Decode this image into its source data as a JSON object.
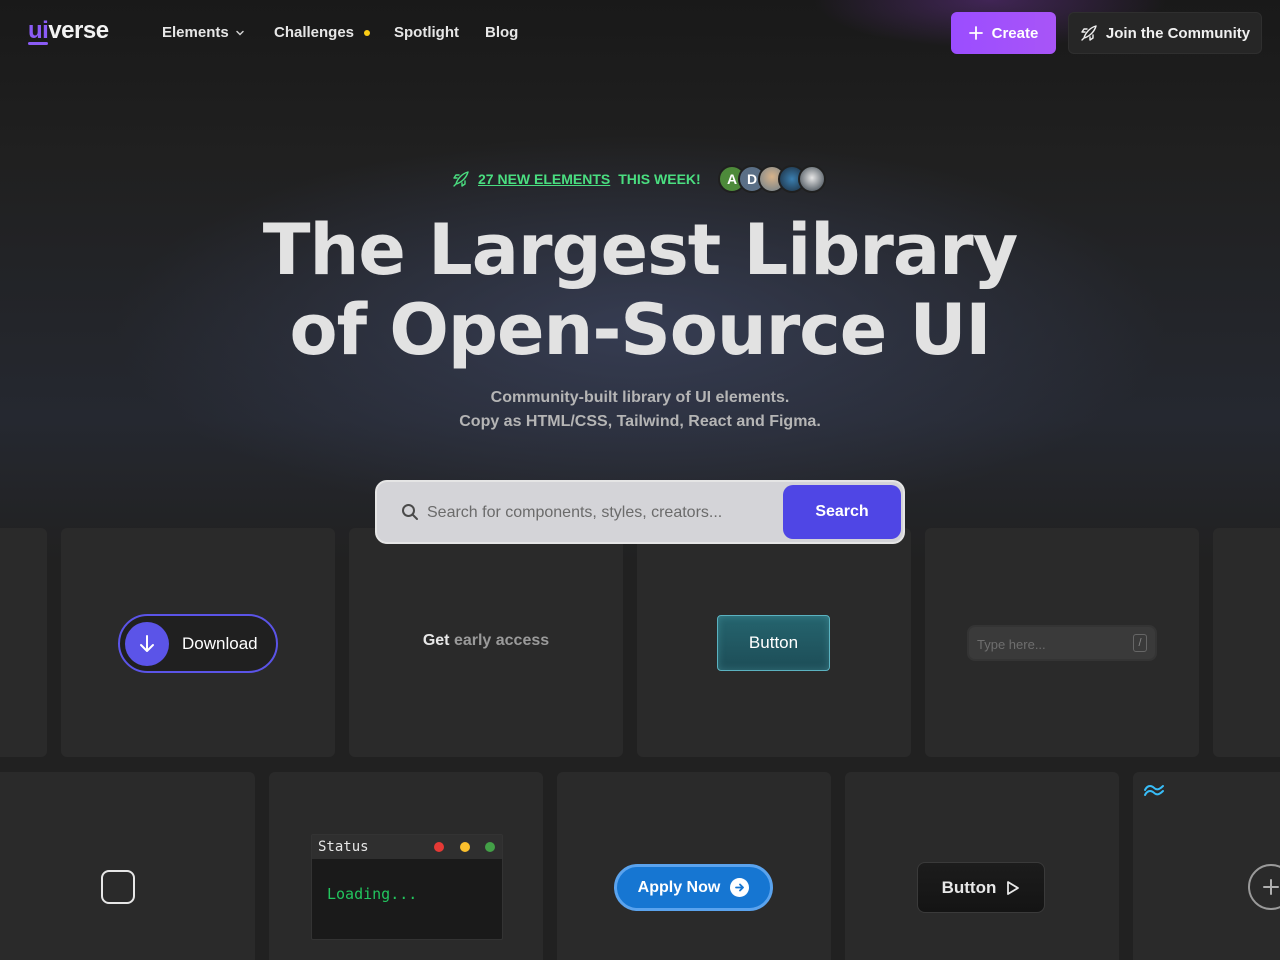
{
  "nav": {
    "logo_accent": "ui",
    "logo_rest": "verse",
    "items": [
      {
        "label": "Elements"
      },
      {
        "label": "Challenges"
      },
      {
        "label": "Spotlight"
      },
      {
        "label": "Blog"
      }
    ],
    "create_label": "Create",
    "join_label": "Join the Community"
  },
  "hero": {
    "badge_count_label": "27 NEW ELEMENTS",
    "badge_suffix": "THIS WEEK!",
    "avatars": [
      "A",
      "D",
      "",
      "",
      ""
    ],
    "headline_line1": "The Largest Library",
    "headline_line2": "of Open-Source UI",
    "sub_line1": "Community-built library of UI elements.",
    "sub_line2": "Copy as HTML/CSS, Tailwind, React and Figma."
  },
  "search": {
    "placeholder": "Search for components, styles, creators...",
    "button_label": "Search"
  },
  "cards": {
    "download_label": "Download",
    "early_prefix": "Get",
    "early_rest": " early access",
    "teal_button_label": "Button",
    "type_placeholder": "Type here...",
    "type_key": "/",
    "terminal_title": "Status",
    "terminal_text": "Loading...",
    "apply_label": "Apply Now",
    "dark_button_label": "Button"
  },
  "colors": {
    "accent": "#8b5cf6",
    "create_gradient": [
      "#9b4dff",
      "#a855f7"
    ],
    "search_button": "#4f46e5",
    "badge_green": "#4ade80",
    "download_blue": "#5b54e8",
    "apply_blue": "#1676d2",
    "background": "#212121"
  },
  "icons": [
    "chevron-down-icon",
    "plus-icon",
    "rocket-icon",
    "search-icon",
    "arrow-down-icon",
    "arrow-right-icon",
    "play-icon",
    "tailwind-icon",
    "plus-circle-icon"
  ]
}
